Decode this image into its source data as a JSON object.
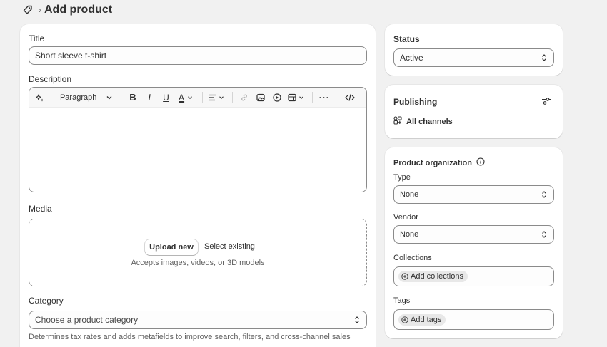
{
  "header": {
    "title": "Add product"
  },
  "main": {
    "title_label": "Title",
    "title_value": "Short sleeve t-shirt",
    "description_label": "Description",
    "toolbar": {
      "paragraph_label": "Paragraph"
    },
    "media_label": "Media",
    "upload_new": "Upload new",
    "select_existing": "Select existing",
    "accepts_text": "Accepts images, videos, or 3D models",
    "category_label": "Category",
    "category_placeholder": "Choose a product category",
    "category_helper": "Determines tax rates and adds metafields to improve search, filters, and cross-channel sales"
  },
  "status": {
    "heading": "Status",
    "value": "Active"
  },
  "publishing": {
    "heading": "Publishing",
    "channels": "All channels"
  },
  "organization": {
    "heading": "Product organization",
    "type_label": "Type",
    "type_value": "None",
    "vendor_label": "Vendor",
    "vendor_value": "None",
    "collections_label": "Collections",
    "collections_button": "Add collections",
    "tags_label": "Tags",
    "tags_button": "Add tags"
  }
}
